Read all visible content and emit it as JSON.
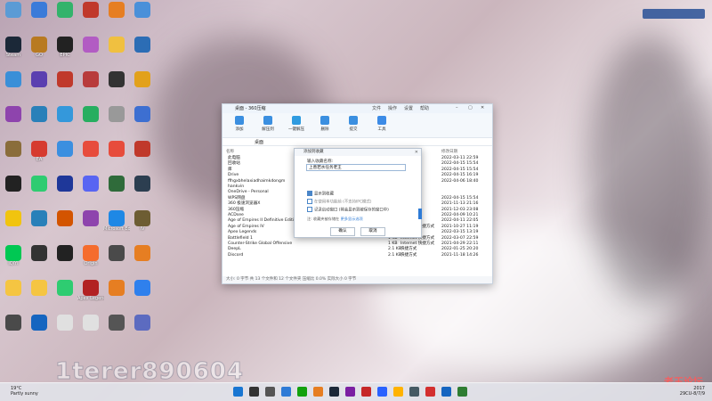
{
  "desktop_icons": [
    {
      "label": "",
      "color": "#5b9bd5"
    },
    {
      "label": "",
      "color": "#3b7bd9"
    },
    {
      "label": "",
      "color": "#33b36b"
    },
    {
      "label": "",
      "color": "#c0392b"
    },
    {
      "label": "",
      "color": "#e67e22"
    },
    {
      "label": "",
      "color": "#4a90d9"
    },
    {
      "label": "Steam",
      "color": "#1b2838"
    },
    {
      "label": "GO",
      "color": "#b87a21"
    },
    {
      "label": "EPIC",
      "color": "#222222"
    },
    {
      "label": "",
      "color": "#b25cc3"
    },
    {
      "label": "",
      "color": "#f0c040"
    },
    {
      "label": "",
      "color": "#2c6db5"
    },
    {
      "label": "",
      "color": "#3a8fd8"
    },
    {
      "label": "",
      "color": "#5a3fb0"
    },
    {
      "label": "",
      "color": "#c0392b"
    },
    {
      "label": "",
      "color": "#b83b3b"
    },
    {
      "label": "",
      "color": "#333333"
    },
    {
      "label": "",
      "color": "#e2a11b"
    },
    {
      "label": "",
      "color": "#8e44ad"
    },
    {
      "label": "",
      "color": "#2980b9"
    },
    {
      "label": "",
      "color": "#3498db"
    },
    {
      "label": "",
      "color": "#27ae60"
    },
    {
      "label": "",
      "color": "#999999"
    },
    {
      "label": "",
      "color": "#3d6fd1"
    },
    {
      "label": "",
      "color": "#8a6d3b"
    },
    {
      "label": "EA",
      "color": "#d63b2f"
    },
    {
      "label": "",
      "color": "#3b8fe0"
    },
    {
      "label": "",
      "color": "#e74c3c"
    },
    {
      "label": "",
      "color": "#e74c3c"
    },
    {
      "label": "",
      "color": "#c0392b"
    },
    {
      "label": "",
      "color": "#222222"
    },
    {
      "label": "",
      "color": "#2ecc71"
    },
    {
      "label": "",
      "color": "#1e3799"
    },
    {
      "label": "",
      "color": "#5865f2"
    },
    {
      "label": "",
      "color": "#2f6b3a"
    },
    {
      "label": "",
      "color": "#2c3e50"
    },
    {
      "label": "",
      "color": "#f1c40f"
    },
    {
      "label": "",
      "color": "#2980b9"
    },
    {
      "label": "",
      "color": "#d35400"
    },
    {
      "label": "",
      "color": "#8e44ad"
    },
    {
      "label": "Microsoft Edge",
      "color": "#1e88e5"
    },
    {
      "label": "IV",
      "color": "#6d5d33"
    },
    {
      "label": "iQIYI",
      "color": "#00c853"
    },
    {
      "label": "",
      "color": "#333333"
    },
    {
      "label": "",
      "color": "#222222"
    },
    {
      "label": "Origin",
      "color": "#f56c2d"
    },
    {
      "label": "",
      "color": "#4a4a4a"
    },
    {
      "label": "",
      "color": "#e67e22"
    },
    {
      "label": "",
      "color": "#f5c542"
    },
    {
      "label": "",
      "color": "#f5c542"
    },
    {
      "label": "",
      "color": "#2ecc71"
    },
    {
      "label": "Apex Legends",
      "color": "#b22222"
    },
    {
      "label": "",
      "color": "#e67e22"
    },
    {
      "label": "",
      "color": "#2f80ed"
    },
    {
      "label": "",
      "color": "#4a4a4a"
    },
    {
      "label": "",
      "color": "#1565c0"
    },
    {
      "label": "",
      "color": "#e0e0e0"
    },
    {
      "label": "",
      "color": "#e0e0e0"
    },
    {
      "label": "",
      "color": "#555555"
    },
    {
      "label": "",
      "color": "#5c6bc0"
    }
  ],
  "top_widget": "",
  "file_manager": {
    "title": "桌面 - 360压缩",
    "menu": [
      "文件",
      "操作",
      "设置",
      "帮助"
    ],
    "toolbar": [
      {
        "label": "添加"
      },
      {
        "label": "解压到"
      },
      {
        "label": "一键解压"
      },
      {
        "label": "删除"
      },
      {
        "label": "提交"
      },
      {
        "label": "工具"
      }
    ],
    "path": "桌面",
    "columns": {
      "name": "名称",
      "date": "修改日期"
    },
    "rows": [
      {
        "name": "此电脑",
        "size": "",
        "type": "",
        "date": "2022-03-11 22:59"
      },
      {
        "name": "回收站",
        "size": "",
        "type": "",
        "date": "2022-04-15 15:54"
      },
      {
        "name": "库",
        "size": "",
        "type": "",
        "date": "2022-04-15 15:54"
      },
      {
        "name": "Drive",
        "size": "",
        "type": "",
        "date": "2022-04-15 16:19"
      },
      {
        "name": "ffhgxbhelaxiadhaimkdongm",
        "size": "",
        "type": "",
        "date": "2022-04-06 18:40"
      },
      {
        "name": "hankvin",
        "size": "",
        "type": "",
        "date": ""
      },
      {
        "name": "OneDrive - Personal",
        "size": "",
        "type": "",
        "date": ""
      },
      {
        "name": "WPS网盘",
        "size": "",
        "type": "",
        "date": "2022-04-15 15:54"
      },
      {
        "name": "360 极速浏览器X",
        "size": "",
        "type": "",
        "date": "2021-11-13 21:16"
      },
      {
        "name": "360压缩",
        "size": "",
        "type": "",
        "date": "2021-12-03 23:08"
      },
      {
        "name": "ACDsee",
        "size": "",
        "type": "",
        "date": "2022-04-09 10:21"
      },
      {
        "name": "Age of Empires II Definitive Edition",
        "size": "",
        "type": "",
        "date": "2022-04-11 22:05"
      },
      {
        "name": "Age of Empires IV",
        "size": "1 KB",
        "type": "Internet 快捷方式",
        "date": "2021-10-27 11:19"
      },
      {
        "name": "Apex Legends",
        "size": "1 KB",
        "type": "快捷方式",
        "date": "2022-03-15 13:19"
      },
      {
        "name": "Battlefield 1",
        "size": "1 KB",
        "type": "Internet 快捷方式",
        "date": "2022-03-07 22:59"
      },
      {
        "name": "Counter-Strike Global Offensive",
        "size": "1 KB",
        "type": "Internet 快捷方式",
        "date": "2021-04-29 22:11"
      },
      {
        "name": "DeepL",
        "size": "2.1 KB",
        "type": "快捷方式",
        "date": "2022-01-25 20:20"
      },
      {
        "name": "Discord",
        "size": "2.1 KB",
        "type": "快捷方式",
        "date": "2021-11-18 14:26"
      }
    ],
    "status": "大小: 0 字节 共 13 个文件和 12 个文件夹 压缩比 0.0% 实际大小 0 字节"
  },
  "dialog": {
    "title": "添加到收藏",
    "label": "输入收藏名称:",
    "value": "上善若水任务老王",
    "check1": "显示到收藏",
    "check2": "在使用本功能前 (不支持IPC模式)",
    "check3": "记录启动窗口 (将会显示到被保存的窗口中)",
    "note": "注: 收藏夹被存储在 ",
    "note_link": "更多显示选项",
    "ok": "确认",
    "cancel": "取消"
  },
  "taskbar": {
    "temp": "19°C",
    "weather": "Partly sunny",
    "time": "2017",
    "date": "29CU-8/7/9"
  },
  "watermark": "1terer890604",
  "watermark_site": "老王论坛"
}
